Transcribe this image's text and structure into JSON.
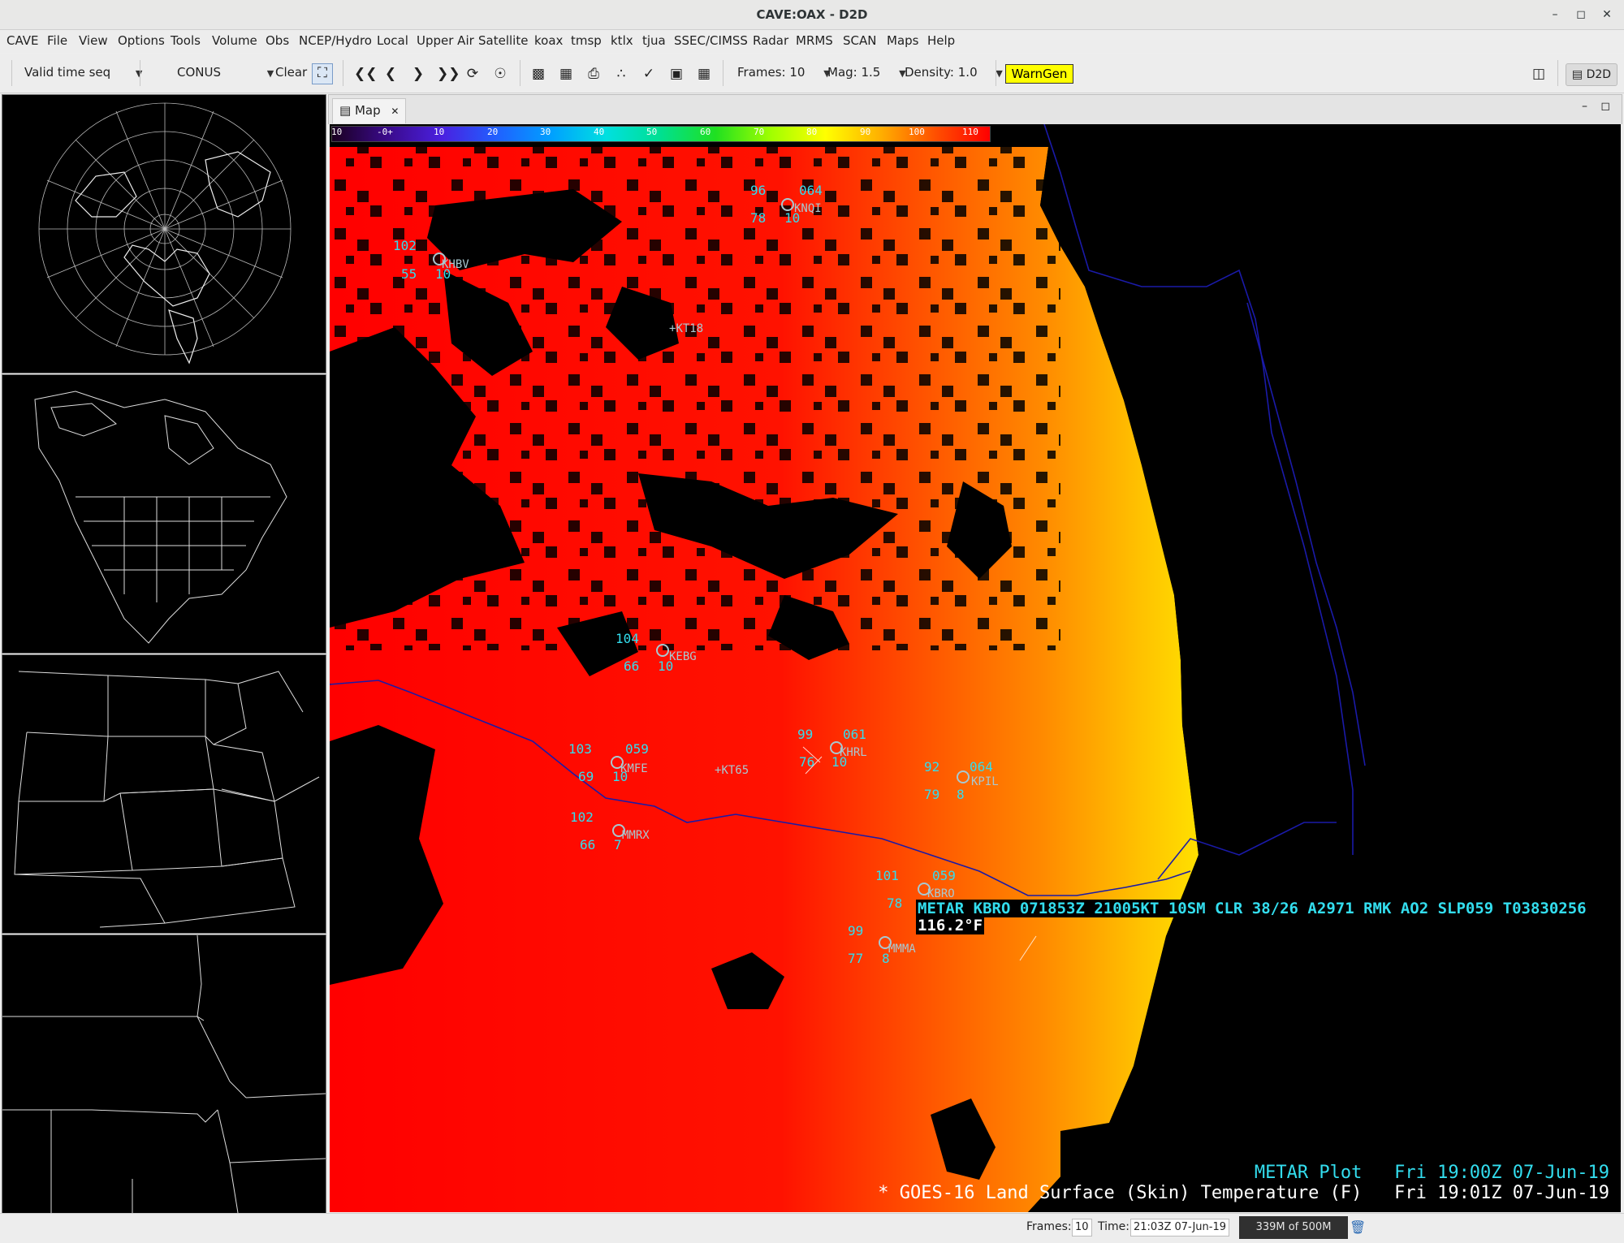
{
  "window": {
    "title": "CAVE:OAX - D2D"
  },
  "menu": [
    "CAVE",
    "File",
    "View",
    "Options",
    "Tools",
    "Volume",
    "Obs",
    "NCEP/Hydro",
    "Local",
    "Upper Air",
    "Satellite",
    "koax",
    "tmsp",
    "ktlx",
    "tjua",
    "SSEC/CIMSS",
    "Radar",
    "MRMS",
    "SCAN",
    "Maps",
    "Help"
  ],
  "toolbar": {
    "time_mode": "Valid time seq",
    "scale": "CONUS",
    "clear": "Clear",
    "frames_label": "Frames: 10",
    "mag_label": "Mag: 1.5",
    "density_label": "Density: 1.0",
    "warngen": "WarnGen",
    "perspective": "D2D"
  },
  "tab": {
    "label": "Map"
  },
  "colorbar": {
    "ticks": [
      "10",
      "-0+",
      "10",
      "20",
      "30",
      "40",
      "50",
      "60",
      "70",
      "80",
      "90",
      "100",
      "110"
    ],
    "colors": [
      "#1a0020",
      "#3a0a8a",
      "#4a20e0",
      "#2060ff",
      "#00a0ff",
      "#00e0e0",
      "#00e090",
      "#20e020",
      "#a0ff00",
      "#ffff00",
      "#ffb000",
      "#ff5000",
      "#ff0000"
    ]
  },
  "stations": [
    {
      "id": "KHBV",
      "temp": "102",
      "dew": "55",
      "extra": "",
      "vis": "10"
    },
    {
      "id": "KNQI",
      "temp": "96",
      "dew": "78",
      "extra": "064",
      "vis": "10"
    },
    {
      "id": "KT18",
      "temp": "",
      "dew": "",
      "extra": "",
      "vis": ""
    },
    {
      "id": "KEBG",
      "temp": "104",
      "dew": "66",
      "extra": "",
      "vis": "10"
    },
    {
      "id": "KMFE",
      "temp": "103",
      "dew": "69",
      "extra": "059",
      "vis": "10"
    },
    {
      "id": "KT65",
      "temp": "",
      "dew": "",
      "extra": "",
      "vis": ""
    },
    {
      "id": "KHRL",
      "temp": "99",
      "dew": "76",
      "extra": "061",
      "vis": "10"
    },
    {
      "id": "KPIL",
      "temp": "92",
      "dew": "79",
      "extra": "064",
      "vis": "8"
    },
    {
      "id": "MMRX",
      "temp": "102",
      "dew": "66",
      "extra": "",
      "vis": "7"
    },
    {
      "id": "KBRO",
      "temp": "101",
      "dew": "78",
      "extra": "059",
      "vis": ""
    },
    {
      "id": "MMMA",
      "temp": "99",
      "dew": "77",
      "extra": "",
      "vis": "8"
    }
  ],
  "sample": {
    "metar": "METAR KBRO 071853Z 21005KT 10SM CLR 38/26 A2971 RMK AO2 SLP059 T03830256",
    "value": "116.2°F"
  },
  "legend": [
    {
      "name": "METAR Plot",
      "time": "Fri 19:00Z 07-Jun-19",
      "color": "#33ddee"
    },
    {
      "name": "GOES-16 Land Surface (Skin) Temperature (F)",
      "time": "Fri 19:01Z 07-Jun-19",
      "color": "#ffffff"
    }
  ],
  "status": {
    "frames_label": "Frames:",
    "frames_value": "10",
    "time_label": "Time:",
    "time_value": "21:03Z 07-Jun-19",
    "memory": "339M of 500M"
  }
}
